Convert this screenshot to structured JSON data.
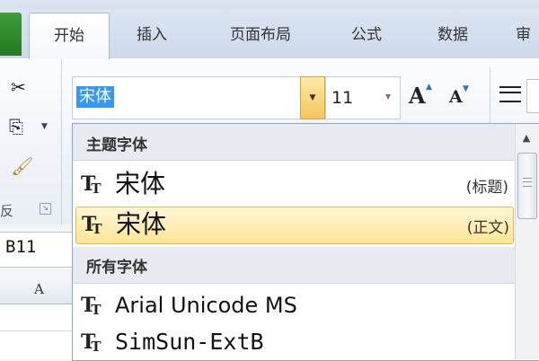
{
  "ribbon": {
    "tabs": [
      {
        "label": "开始",
        "active": true
      },
      {
        "label": "插入"
      },
      {
        "label": "页面布局"
      },
      {
        "label": "公式"
      },
      {
        "label": "数据"
      },
      {
        "label": "审"
      }
    ],
    "clipboard_group_label": "反",
    "font_combo_value": "宋体",
    "size_combo_value": "11",
    "grow_font_glyph": "A",
    "shrink_font_glyph": "A",
    "accent_color": "#2a6fd1"
  },
  "name_box": "B11",
  "grid": {
    "column_header": "A"
  },
  "font_dropdown": {
    "sections": [
      {
        "title": "主题字体"
      },
      {
        "title": "所有字体"
      }
    ],
    "items": [
      {
        "name": "宋体",
        "tag": "(标题)",
        "selected": false,
        "icon": "truetype-icon"
      },
      {
        "name": "宋体",
        "tag": "(正文)",
        "selected": true,
        "icon": "truetype-icon"
      },
      {
        "name": "Arial Unicode MS",
        "tag": "",
        "selected": false,
        "icon": "truetype-icon"
      },
      {
        "name": "SimSun-ExtB",
        "tag": "",
        "selected": false,
        "icon": "truetype-icon"
      }
    ],
    "highlight_color": "#ffe594"
  },
  "icons": [
    "scissors-icon",
    "copy-icon",
    "format-painter-icon",
    "dialog-launcher-icon",
    "grow-font-icon",
    "shrink-font-icon",
    "align-icon",
    "truetype-icon",
    "scroll-up-icon"
  ]
}
